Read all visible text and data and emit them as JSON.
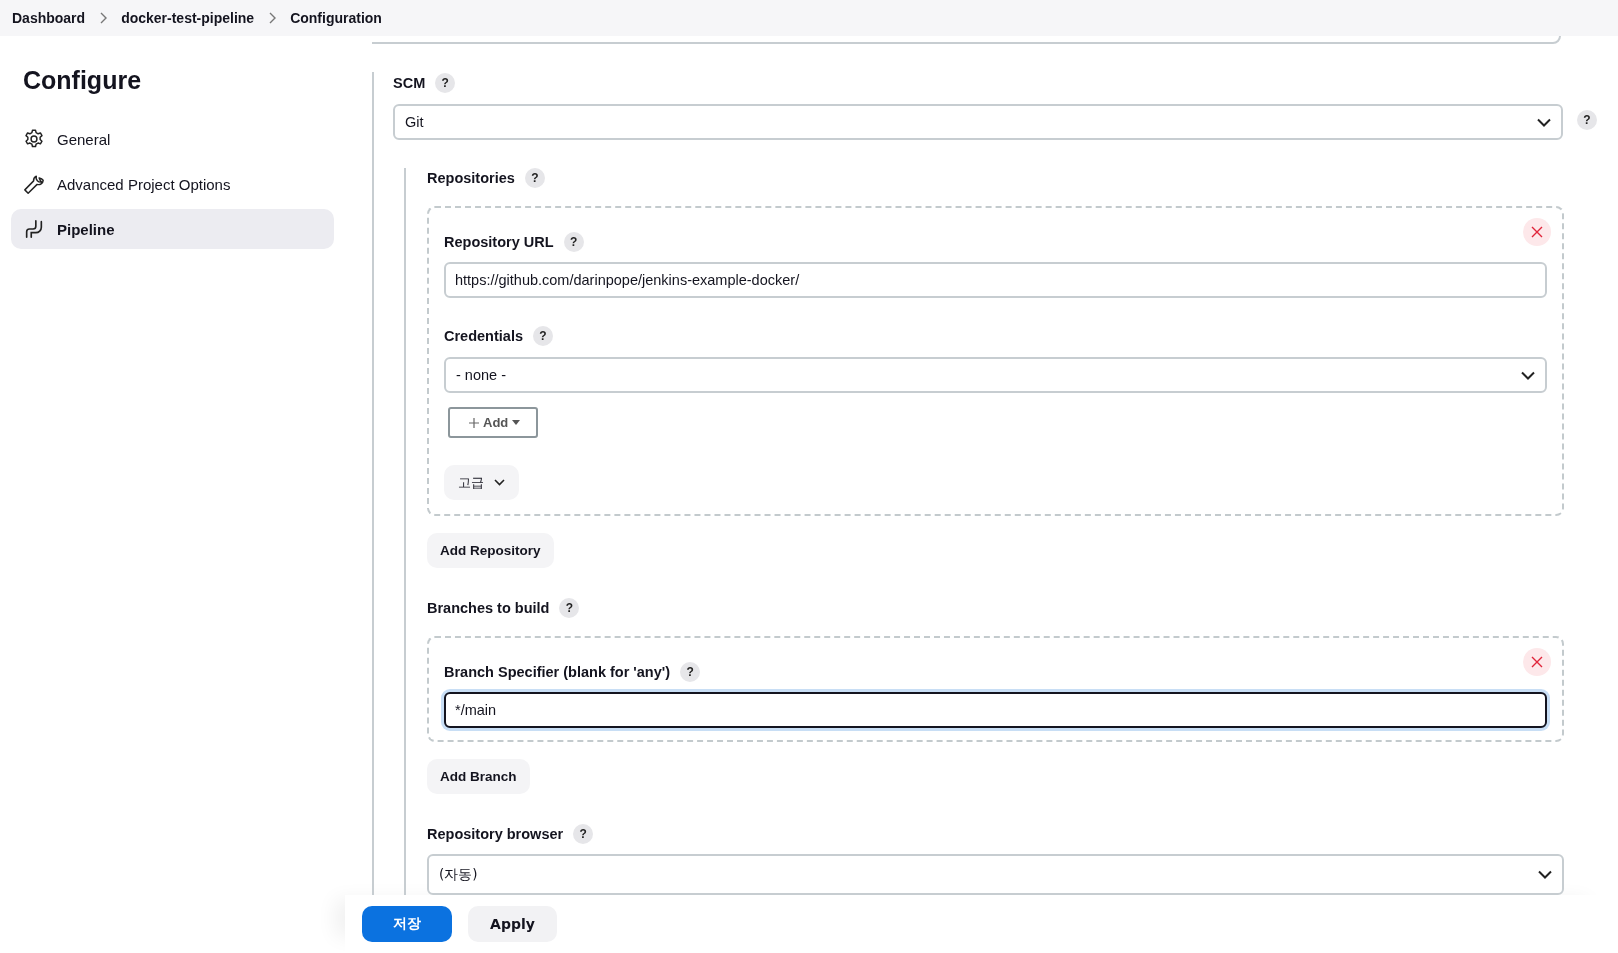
{
  "breadcrumbs": [
    {
      "label": "Dashboard"
    },
    {
      "label": "docker-test-pipeline"
    },
    {
      "label": "Configuration"
    }
  ],
  "sidebar": {
    "title": "Configure",
    "items": [
      {
        "label": "General",
        "kind": "gear",
        "selected": false
      },
      {
        "label": "Advanced Project Options",
        "kind": "wrench",
        "selected": false
      },
      {
        "label": "Pipeline",
        "kind": "pipeline",
        "selected": true
      }
    ]
  },
  "scm": {
    "label": "SCM",
    "help": "?",
    "value": "Git",
    "side_help": "?"
  },
  "repositories": {
    "label": "Repositories",
    "help": "?",
    "items": [
      {
        "url_label": "Repository URL",
        "url_help": "?",
        "url": "https://github.com/darinpope/jenkins-example-docker/",
        "credentials_label": "Credentials",
        "credentials_help": "?",
        "credentials": "- none -",
        "add_label": "Add",
        "advanced_label": "고급"
      }
    ],
    "add_label": "Add Repository"
  },
  "branches": {
    "label": "Branches to build",
    "help": "?",
    "items": [
      {
        "label": "Branch Specifier (blank for 'any')",
        "help": "?",
        "value": "*/main",
        "focused": true
      }
    ],
    "add_label": "Add Branch"
  },
  "repository_browser": {
    "label": "Repository browser",
    "help": "?",
    "value": "(자동)"
  },
  "footer": {
    "buttons": [
      {
        "label": "저장",
        "kind": "primary"
      },
      {
        "label": "Apply",
        "kind": "secondary"
      }
    ]
  }
}
